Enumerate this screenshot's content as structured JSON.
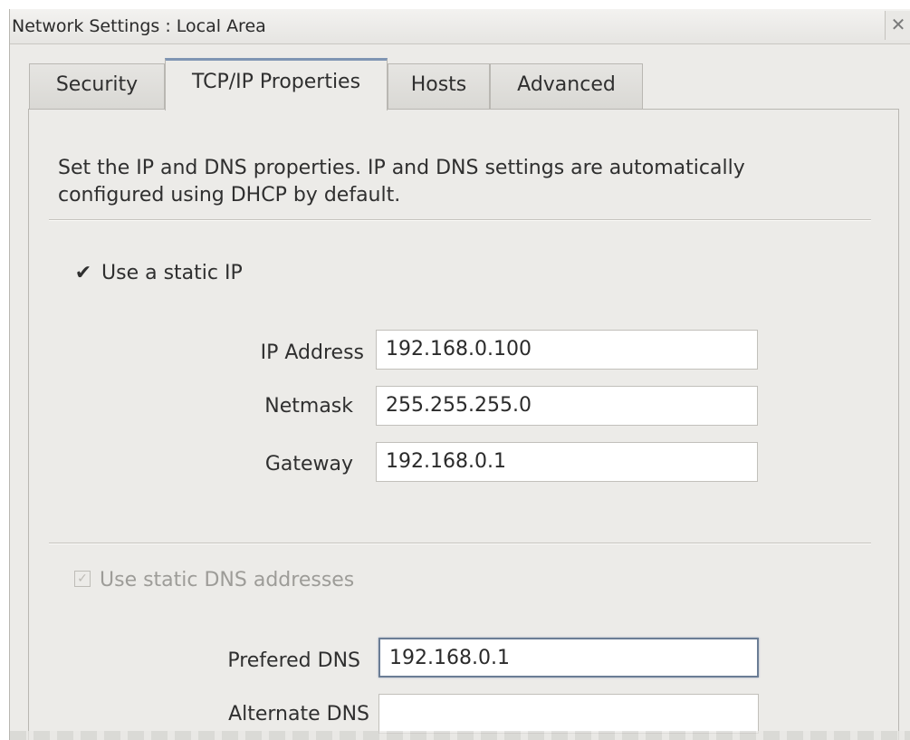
{
  "window": {
    "title": "Network Settings : Local Area",
    "close_icon": "close-icon"
  },
  "tabs": [
    {
      "label": "Security",
      "active": false
    },
    {
      "label": "TCP/IP Properties",
      "active": true
    },
    {
      "label": "Hosts",
      "active": false
    },
    {
      "label": "Advanced",
      "active": false
    }
  ],
  "panel": {
    "description": "Set the IP and DNS properties. IP and DNS settings are automatically configured using DHCP by default.",
    "static_ip": {
      "label": "Use a static IP",
      "checked": true,
      "enabled": true
    },
    "ip_fields": [
      {
        "label": "IP Address",
        "value": "192.168.0.100"
      },
      {
        "label": "Netmask",
        "value": "255.255.255.0"
      },
      {
        "label": "Gateway",
        "value": "192.168.0.1"
      }
    ],
    "static_dns": {
      "label": "Use static DNS addresses",
      "checked": true,
      "enabled": false
    },
    "dns_fields": [
      {
        "label": "Prefered DNS",
        "value": "192.168.0.1",
        "focused": true
      },
      {
        "label": "Alternate DNS",
        "value": "",
        "focused": false
      }
    ]
  },
  "colors": {
    "window_bg": "#ecebe8",
    "active_tab_accent": "#7f95b3",
    "focus_border": "#6b7d95"
  }
}
